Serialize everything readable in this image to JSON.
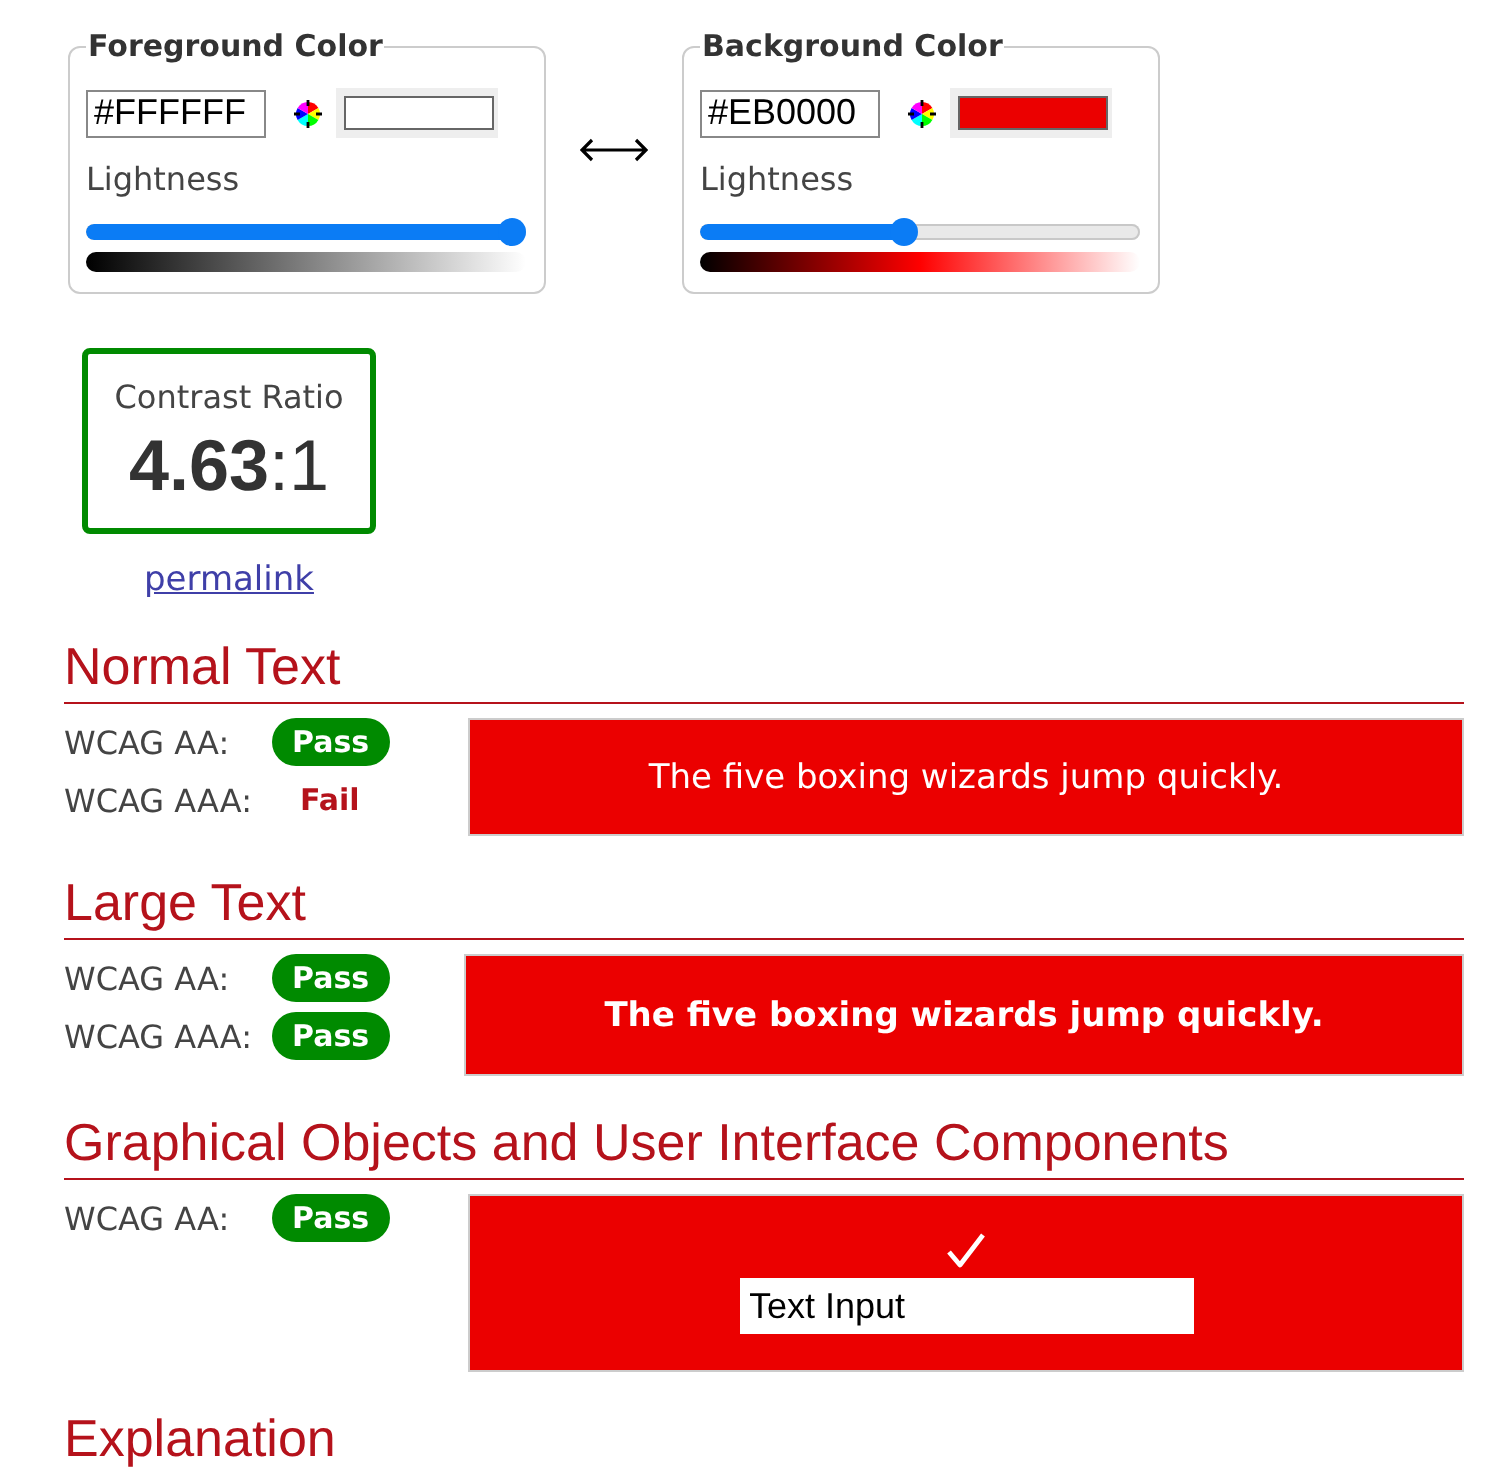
{
  "color_pickers": [
    {
      "legend": "Foreground Color",
      "hex": "#FFFFFF",
      "color": "#ffffff",
      "lightness_label": "Lightness",
      "level": 1
    },
    {
      "legend": "Background Color",
      "hex": "#EB0000",
      "color": "#eb0000",
      "lightness_label": "Lightness",
      "level": 0.46
    }
  ],
  "contrast": {
    "label": "Contrast Ratio",
    "ratio": "**4.63**:1",
    "passed": true
  },
  "permalink": "permalink",
  "sections": [
    {
      "title": "Normal Text",
      "results": [
        {
          "label": "WCAG AA:",
          "result": "Pass",
          "passed": true
        },
        {
          "label": "WCAG AAA:",
          "result": "Fail",
          "passed": false
        }
      ],
      "preview": {
        "kind": "normal_text",
        "text": "The five boxing wizards jump quickly."
      }
    },
    {
      "title": "Large Text",
      "results": [
        {
          "label": "WCAG AA:",
          "result": "Pass",
          "passed": true
        },
        {
          "label": "WCAG AAA:",
          "result": "Pass",
          "passed": true
        }
      ],
      "preview": {
        "kind": "large_text",
        "text": "The five boxing wizards jump quickly."
      }
    },
    {
      "title": "Graphical Objects and User Interface Components",
      "results": [
        {
          "label": "WCAG AA:",
          "result": "Pass",
          "passed": true
        }
      ],
      "preview": {
        "kind": "ui_components",
        "input_value": "Text Input"
      }
    },
    {
      "title": "Explanation"
    }
  ]
}
